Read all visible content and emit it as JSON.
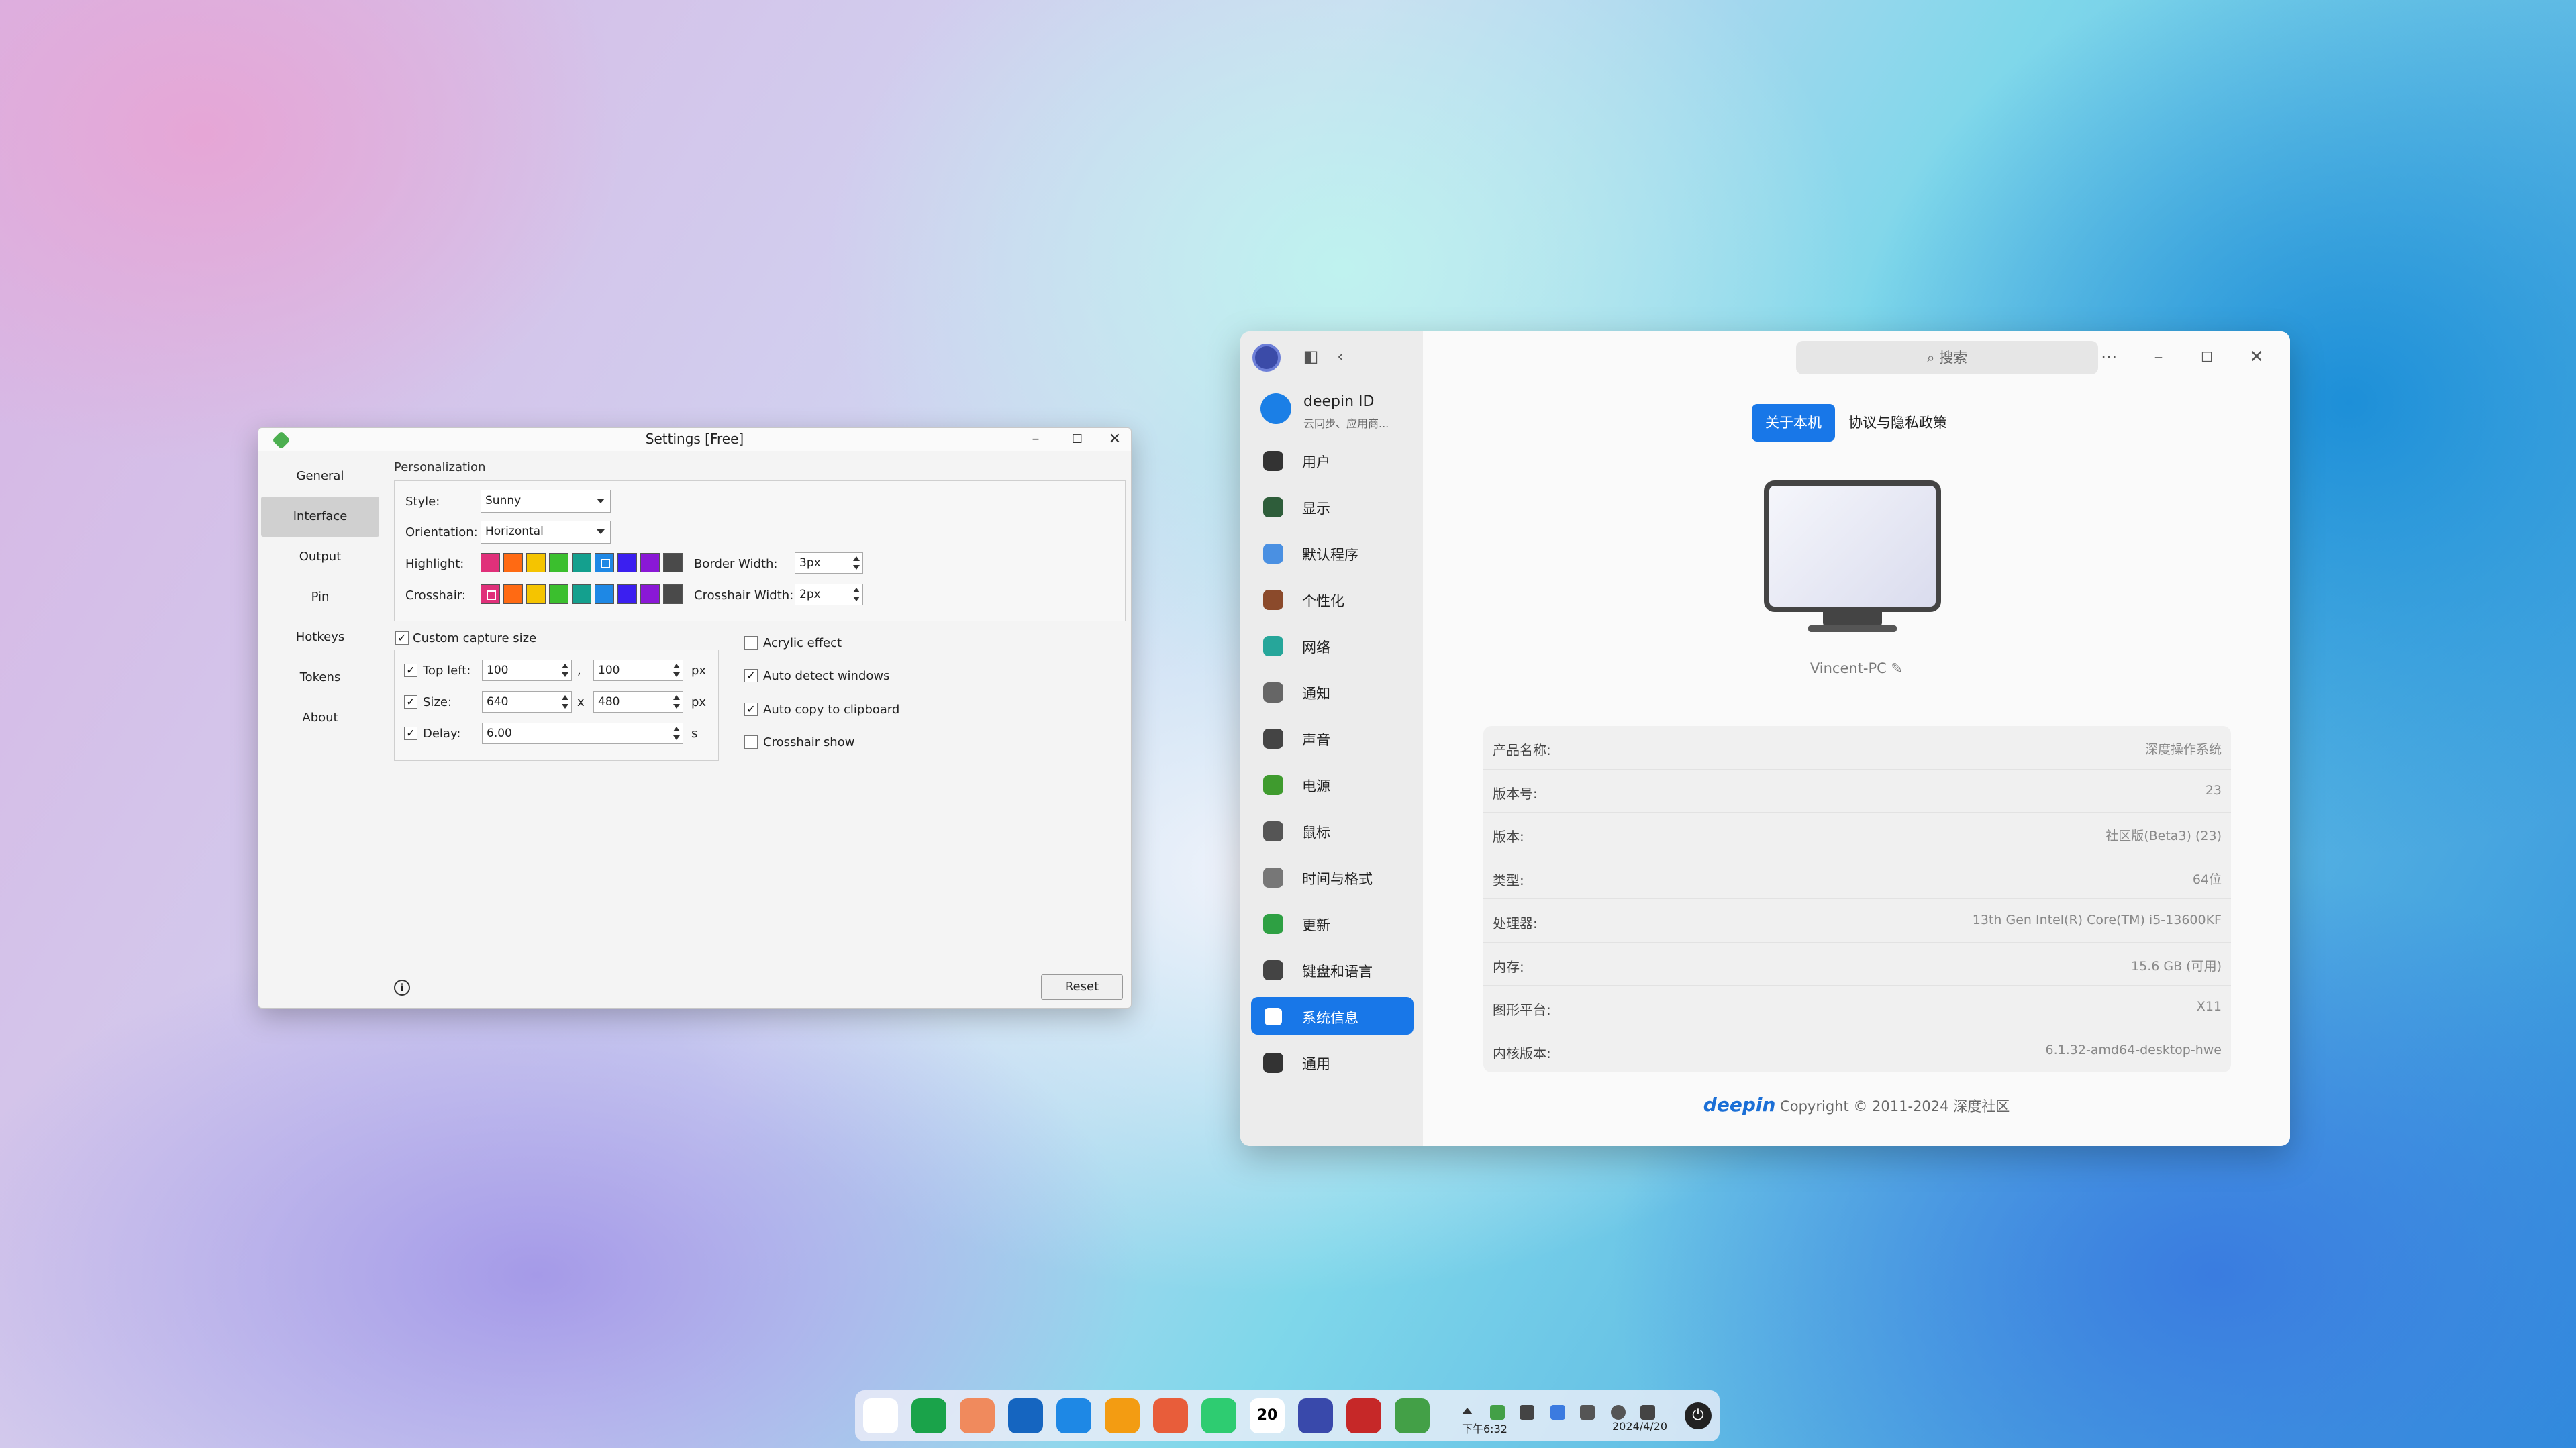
{
  "settings": {
    "title": "Settings [Free]",
    "sidebar": [
      "General",
      "Interface",
      "Output",
      "Pin",
      "Hotkeys",
      "Tokens",
      "About"
    ],
    "active_item": "Interface",
    "section_title": "Personalization",
    "style_label": "Style:",
    "style_value": "Sunny",
    "orientation_label": "Orientation:",
    "orientation_value": "Horizontal",
    "highlight_label": "Highlight:",
    "crosshair_label": "Crosshair:",
    "border_width_label": "Border Width:",
    "border_width_value": "3px",
    "crosshair_width_label": "Crosshair Width:",
    "crosshair_width_value": "2px",
    "swatch_colors": [
      "#e0307a",
      "#ff6a13",
      "#f5c400",
      "#3bbf2e",
      "#14a08e",
      "#1e88e5",
      "#3b1ff0",
      "#8a18d6",
      "#4a4a4a"
    ],
    "custom_capture_label": "Custom capture size",
    "top_left_label": "Top left:",
    "top_left_x": "100",
    "top_left_y": "100",
    "comma": ",",
    "px1": "px",
    "size_label": "Size:",
    "size_w": "640",
    "size_h": "480",
    "x_sep": "x",
    "px2": "px",
    "delay_label": "Delay:",
    "delay_value": "6.00",
    "seconds": "s",
    "acrylic_label": "Acrylic effect",
    "auto_detect_label": "Auto detect windows",
    "auto_copy_label": "Auto copy to clipboard",
    "crosshair_show_label": "Crosshair show",
    "info_glyph": "i",
    "reset_label": "Reset"
  },
  "control_center": {
    "search_placeholder": "搜索",
    "deepin_id_title": "deepin ID",
    "deepin_id_sub": "云同步、应用商...",
    "nav": [
      {
        "label": "用户",
        "icon": "user-icon",
        "color": "#333333"
      },
      {
        "label": "显示",
        "icon": "display-icon",
        "color": "#2e5d3a"
      },
      {
        "label": "默认程序",
        "icon": "default-apps-icon",
        "color": "#4a90e2"
      },
      {
        "label": "个性化",
        "icon": "personalization-icon",
        "color": "#8b4a2b"
      },
      {
        "label": "网络",
        "icon": "network-icon",
        "color": "#26a69a"
      },
      {
        "label": "通知",
        "icon": "notification-icon",
        "color": "#666666"
      },
      {
        "label": "声音",
        "icon": "sound-icon",
        "color": "#444444"
      },
      {
        "label": "电源",
        "icon": "power-icon",
        "color": "#3f9b2e"
      },
      {
        "label": "鼠标",
        "icon": "mouse-icon",
        "color": "#555555"
      },
      {
        "label": "时间与格式",
        "icon": "clock-icon",
        "color": "#777777"
      },
      {
        "label": "更新",
        "icon": "update-icon",
        "color": "#2ea043"
      },
      {
        "label": "键盘和语言",
        "icon": "keyboard-icon",
        "color": "#444444"
      },
      {
        "label": "系统信息",
        "icon": "system-info-icon",
        "color": "#ffffff"
      },
      {
        "label": "通用",
        "icon": "general-icon",
        "color": "#333333"
      }
    ],
    "active_nav": "系统信息",
    "tabs": [
      "关于本机",
      "协议与隐私政策"
    ],
    "pc_name": "Vincent-PC",
    "info_rows": [
      {
        "key": "产品名称:",
        "value": "深度操作系统"
      },
      {
        "key": "版本号:",
        "value": "23"
      },
      {
        "key": "版本:",
        "value": "社区版(Beta3) (23)"
      },
      {
        "key": "类型:",
        "value": "64位"
      },
      {
        "key": "处理器:",
        "value": "13th Gen Intel(R) Core(TM) i5-13600KF"
      },
      {
        "key": "内存:",
        "value": "15.6 GB (可用)"
      },
      {
        "key": "图形平台:",
        "value": "X11"
      },
      {
        "key": "内核版本:",
        "value": "6.1.32-amd64-desktop-hwe"
      }
    ],
    "brand": "deepin",
    "copyright": "Copyright © 2011-2024 深度社区"
  },
  "dock": {
    "apps": [
      {
        "name": "launcher-icon",
        "color": "#ffffff"
      },
      {
        "name": "multitasking-icon",
        "color": "#1aa34a"
      },
      {
        "name": "app-grid-icon",
        "color": "#f08a5d"
      },
      {
        "name": "app-store-icon",
        "color": "#1565c0"
      },
      {
        "name": "browser-icon",
        "color": "#1e88e5"
      },
      {
        "name": "file-manager-icon",
        "color": "#f39c12"
      },
      {
        "name": "image-viewer-icon",
        "color": "#e85d3a"
      },
      {
        "name": "music-icon",
        "color": "#2ecc71"
      },
      {
        "name": "calendar-icon",
        "color": "#ffffff"
      },
      {
        "name": "control-center-icon",
        "color": "#3949ab"
      },
      {
        "name": "terminal-icon",
        "color": "#c62828"
      },
      {
        "name": "screenshot-tool-icon",
        "color": "#43a047"
      }
    ],
    "calendar_day": "20",
    "time": "下午6:32",
    "date": "2024/4/20"
  }
}
